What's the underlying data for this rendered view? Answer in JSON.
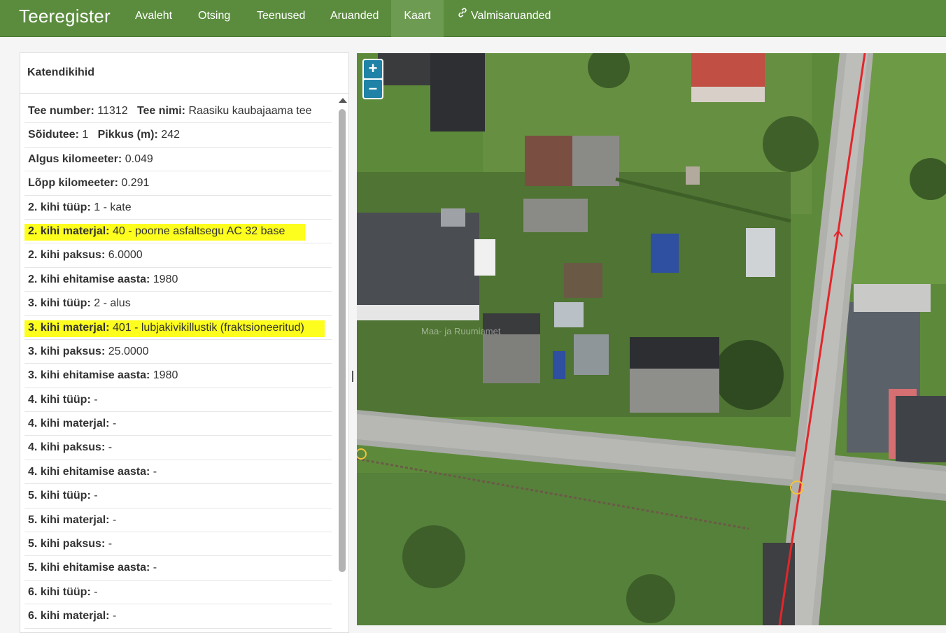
{
  "brand": "Teeregister",
  "nav": [
    {
      "label": "Avaleht"
    },
    {
      "label": "Otsing"
    },
    {
      "label": "Teenused"
    },
    {
      "label": "Aruanded"
    },
    {
      "label": "Kaart",
      "active": true
    },
    {
      "label": "Valmisaruanded",
      "icon": "link-icon"
    }
  ],
  "panel": {
    "title": "Katendikihid",
    "rows": [
      {
        "k1": "Tee number:",
        "v1": "11312",
        "k2": "Tee nimi:",
        "v2": "Raasiku kaubajaama tee"
      },
      {
        "k1": "Sõidutee:",
        "v1": "1",
        "k2": "Pikkus (m):",
        "v2": "242"
      },
      {
        "k1": "Algus kilomeeter:",
        "v1": "0.049"
      },
      {
        "k1": "Lõpp kilomeeter:",
        "v1": "0.291"
      },
      {
        "k1": "2. kihi tüüp:",
        "v1": "1 - kate"
      },
      {
        "k1": "2. kihi materjal:",
        "v1": "40 - poorne asfaltsegu AC 32 base",
        "highlighted": true
      },
      {
        "k1": "2. kihi paksus:",
        "v1": "6.0000"
      },
      {
        "k1": "2. kihi ehitamise aasta:",
        "v1": "1980"
      },
      {
        "k1": "3. kihi tüüp:",
        "v1": "2 - alus"
      },
      {
        "k1": "3. kihi materjal:",
        "v1": "401 - lubjakivikillustik (fraktsioneeritud)",
        "highlighted": true
      },
      {
        "k1": "3. kihi paksus:",
        "v1": "25.0000"
      },
      {
        "k1": "3. kihi ehitamise aasta:",
        "v1": "1980"
      },
      {
        "k1": "4. kihi tüüp:",
        "v1": "-"
      },
      {
        "k1": "4. kihi materjal:",
        "v1": "-"
      },
      {
        "k1": "4. kihi paksus:",
        "v1": "-"
      },
      {
        "k1": "4. kihi ehitamise aasta:",
        "v1": "-"
      },
      {
        "k1": "5. kihi tüüp:",
        "v1": "-"
      },
      {
        "k1": "5. kihi materjal:",
        "v1": "-"
      },
      {
        "k1": "5. kihi paksus:",
        "v1": "-"
      },
      {
        "k1": "5. kihi ehitamise aasta:",
        "v1": "-"
      },
      {
        "k1": "6. kihi tüüp:",
        "v1": "-"
      },
      {
        "k1": "6. kihi materjal:",
        "v1": "-"
      }
    ]
  },
  "map": {
    "zoom_in": "+",
    "zoom_out": "–",
    "watermark": "Maa- ja Ruumiamet"
  },
  "colors": {
    "navbar": "#5b8c3e",
    "highlight": "#fdfd1e",
    "road_line": "#e3262b",
    "zoom_button": "#1f82a6"
  }
}
